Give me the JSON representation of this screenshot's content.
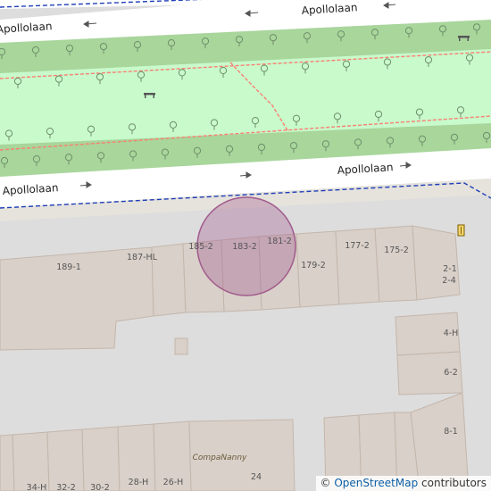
{
  "map": {
    "streets": [
      {
        "name": "Apollolaan"
      },
      {
        "name": "Apollolaan"
      },
      {
        "name": "Apollolaan"
      },
      {
        "name": "Apollolaan"
      }
    ],
    "house_numbers": [
      "189-1",
      "187-HL",
      "185-2",
      "183-2",
      "181-2",
      "179-2",
      "177-2",
      "175-2",
      "2-1",
      "2-4",
      "4-H",
      "6-2",
      "8-1",
      "34-H",
      "32-2",
      "30-2",
      "28-H",
      "26-H",
      "24"
    ],
    "poi_label": "CompaNanny",
    "highlight_color": "#a05a8c",
    "colors": {
      "park": "#c8facc",
      "verge": "#a8d69b",
      "road": "#ffffff",
      "building": "#d9d0c9",
      "bus_route": "#1f3fb8",
      "footpath": "#fa8072"
    },
    "icons": [
      "bench-icon",
      "tree-icon",
      "one-way-arrow-icon",
      "entrance-icon"
    ]
  },
  "attribution": {
    "copyright": "©",
    "link_text": "OpenStreetMap",
    "suffix": " contributors"
  }
}
